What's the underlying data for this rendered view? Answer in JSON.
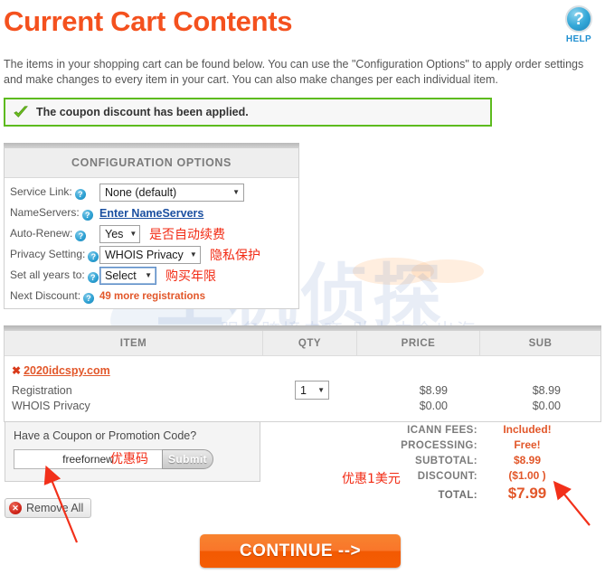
{
  "header": {
    "title": "Current Cart Contents",
    "help_icon": "question-mark-icon",
    "help_label": "HELP"
  },
  "intro": "The items in your shopping cart can be found below. You can use the \"Configuration Options\" to apply order settings and make changes to every item in your cart. You can also make changes per each individual item.",
  "notice": {
    "icon": "green-check-icon",
    "text": "The coupon discount has been applied."
  },
  "config": {
    "header": "CONFIGURATION OPTIONS",
    "rows": [
      {
        "label": "Service Link:",
        "value": "None (default)",
        "kind": "select"
      },
      {
        "label": "NameServers:",
        "value": "Enter NameServers",
        "kind": "link"
      },
      {
        "label": "Auto-Renew:",
        "value": "Yes",
        "kind": "select",
        "note": "是否自动续费"
      },
      {
        "label": "Privacy Setting:",
        "value": "WHOIS Privacy",
        "kind": "select",
        "note": "隐私保护"
      },
      {
        "label": "Set all years to:",
        "value": "Select",
        "kind": "select",
        "note": "购买年限"
      },
      {
        "label": "Next Discount:",
        "value": "49 more registrations",
        "kind": "text"
      }
    ]
  },
  "table": {
    "columns": [
      "ITEM",
      "QTY",
      "PRICE",
      "SUB"
    ],
    "domain": "2020idcspy.com",
    "domain_remove_icon": "remove-x-icon",
    "lines": [
      {
        "name": "Registration",
        "qty": "1",
        "price": "$8.99",
        "sub": "$8.99"
      },
      {
        "name": "WHOIS Privacy",
        "qty": "",
        "price": "$0.00",
        "sub": "$0.00"
      }
    ]
  },
  "coupon": {
    "title": "Have a Coupon or Promotion Code?",
    "value": "freefornew",
    "placeholder": "",
    "submit_label": "Submit",
    "note": "优惠码"
  },
  "remove_all": {
    "icon": "remove-x-circle-icon",
    "label": "Remove All"
  },
  "totals": {
    "rows": [
      {
        "label": "ICANN FEES:",
        "value": "Included!"
      },
      {
        "label": "PROCESSING:",
        "value": "Free!"
      },
      {
        "label": "SUBTOTAL:",
        "value": "$8.99"
      },
      {
        "label": "DISCOUNT:",
        "value": "($1.00 )"
      },
      {
        "label": "TOTAL:",
        "value": "$7.99"
      }
    ],
    "discount_note": "优惠1美元"
  },
  "continue": {
    "label": "CONTINUE -->"
  },
  "watermark": {
    "main": "主机侦探",
    "sub": "服务跨境电商  助力中企出海"
  },
  "colors": {
    "accent_orange": "#f4511e",
    "price_orange": "#e2572a",
    "annotation_red": "#f22b14",
    "success_green": "#5dbb1e",
    "link_blue": "#1a4fa0",
    "help_blue": "#1f8fd0"
  }
}
